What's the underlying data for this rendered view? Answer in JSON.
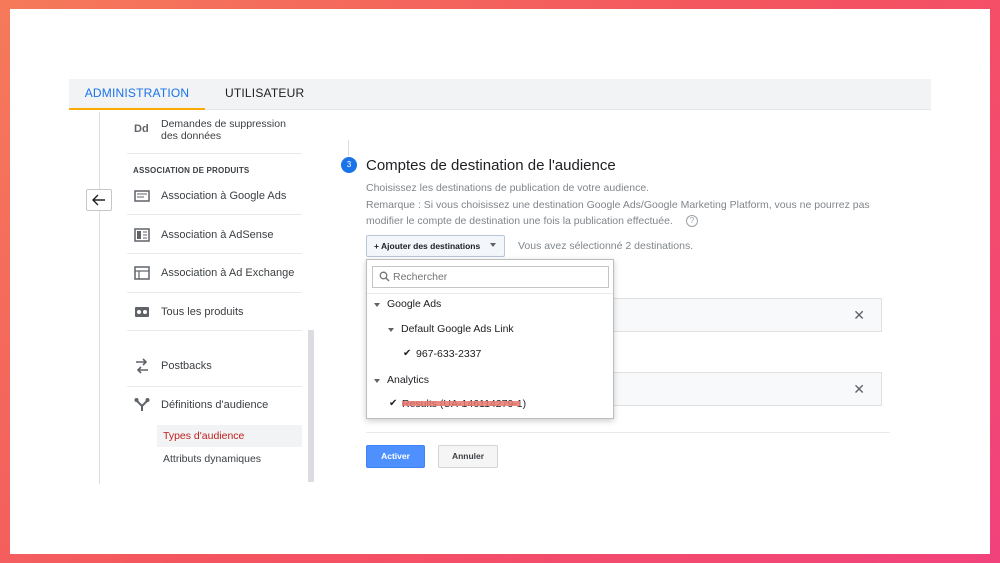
{
  "tabs": {
    "admin": "ADMINISTRATION",
    "user": "UTILISATEUR"
  },
  "nav": {
    "partial_item_line1": "Demandes de suppression",
    "partial_item_line2": "des données",
    "partial_item_icon_text": "Dd",
    "section_title": "ASSOCIATION DE PRODUITS",
    "items": [
      {
        "label": "Association à Google Ads",
        "icon": "google-ads-icon"
      },
      {
        "label": "Association à AdSense",
        "icon": "adsense-icon"
      },
      {
        "label": "Association à Ad Exchange",
        "icon": "ad-exchange-icon"
      },
      {
        "label": "Tous les produits",
        "icon": "products-icon"
      },
      {
        "label": "Postbacks",
        "icon": "postbacks-icon"
      },
      {
        "label": "Définitions d'audience",
        "icon": "audience-definitions-icon"
      }
    ],
    "sub_items": {
      "types": "Types d'audience",
      "attributs": "Attributs dynamiques"
    }
  },
  "step": {
    "number": "3",
    "title": "Comptes de destination de l'audience",
    "desc1": "Choisissez les destinations de publication de votre audience.",
    "desc2": "Remarque : Si vous choisissez une destination Google Ads/Google Marketing Platform, vous ne pourrez pas",
    "desc3": "modifier le compte de destination une fois la publication effectuée.",
    "help": "?"
  },
  "add_destinations": {
    "label": "+ Ajouter des destinations",
    "selected_text": "Vous avez sélectionné 2 destinations."
  },
  "dropdown": {
    "search_placeholder": "Rechercher",
    "groups": [
      {
        "label": "Google Ads"
      },
      {
        "label": "Default Google Ads Link"
      },
      {
        "label": "967-633-2337"
      },
      {
        "label": "Analytics"
      },
      {
        "label": "Results (UA-146114279-1)"
      }
    ]
  },
  "destination_rows": {
    "close_glyph": "✕"
  },
  "buttons": {
    "activate": "Activer",
    "cancel": "Annuler"
  },
  "colors": {
    "accent": "#1a73e8",
    "tab_underline": "#f9ab00",
    "primary_button": "#4d90fe",
    "selected_text": "#c5221f"
  }
}
